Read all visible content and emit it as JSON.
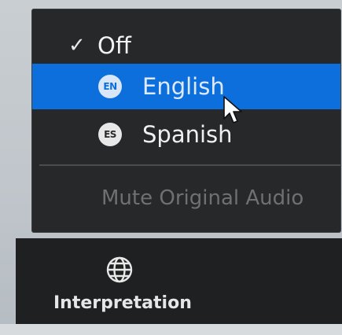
{
  "menu": {
    "off": {
      "check": "✓",
      "label": "Off"
    },
    "languages": [
      {
        "code": "EN",
        "label": "English",
        "highlighted": true
      },
      {
        "code": "ES",
        "label": "Spanish",
        "highlighted": false
      }
    ],
    "mute_label": "Mute Original Audio"
  },
  "toolbar": {
    "interpretation_label": "Interpretation",
    "icon": "globe-icon"
  },
  "colors": {
    "highlight": "#0c6fdc",
    "menu_bg": "#262829",
    "toolbar_bg": "#1f2021",
    "disabled_text": "#6e7174"
  }
}
